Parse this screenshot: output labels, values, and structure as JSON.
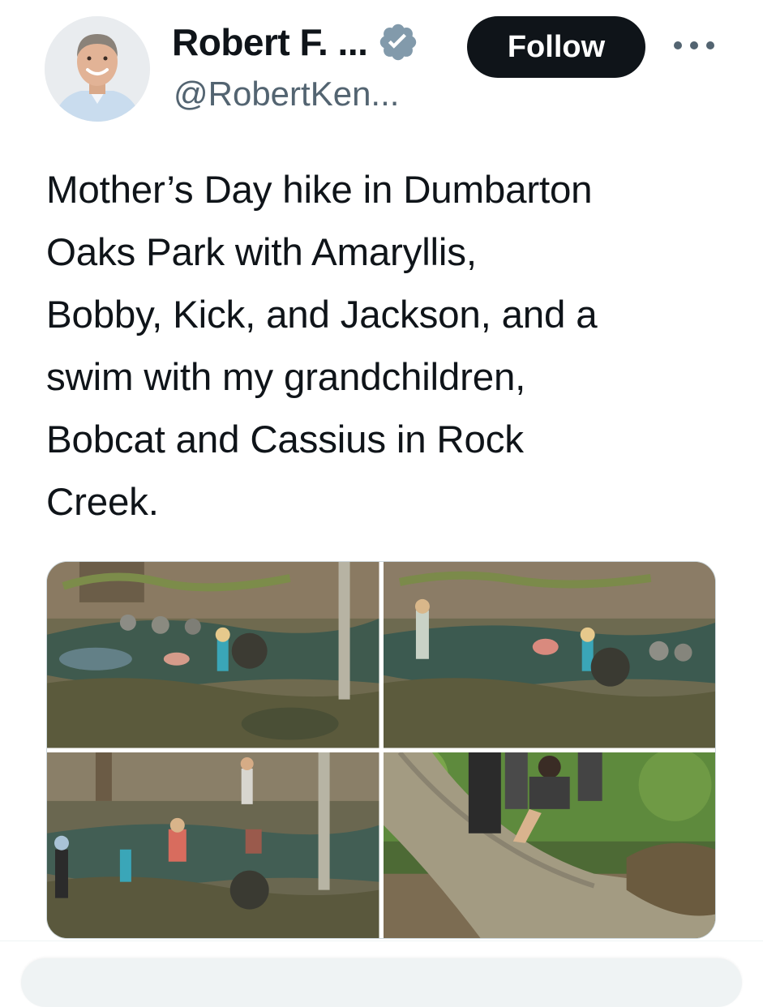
{
  "post": {
    "author": {
      "display_name": "Robert F. ...",
      "handle": "@RobertKen...",
      "verified": true,
      "verified_color": "#829aab"
    },
    "follow_label": "Follow",
    "more_icon": "more-horizontal-icon",
    "text": "Mother’s Day hike in Dumbarton\nOaks Park with Amaryllis,\nBobby, Kick, and Jackson, and a\nswim with my grandchildren,\nBobcat and Cassius in Rock\nCreek.",
    "media": [
      {
        "kind": "photo",
        "subject": "creek-children-swimming"
      },
      {
        "kind": "photo",
        "subject": "creek-children-swimming"
      },
      {
        "kind": "photo",
        "subject": "creek-family-wading"
      },
      {
        "kind": "photo",
        "subject": "fallen-tree-family-sitting"
      }
    ]
  }
}
